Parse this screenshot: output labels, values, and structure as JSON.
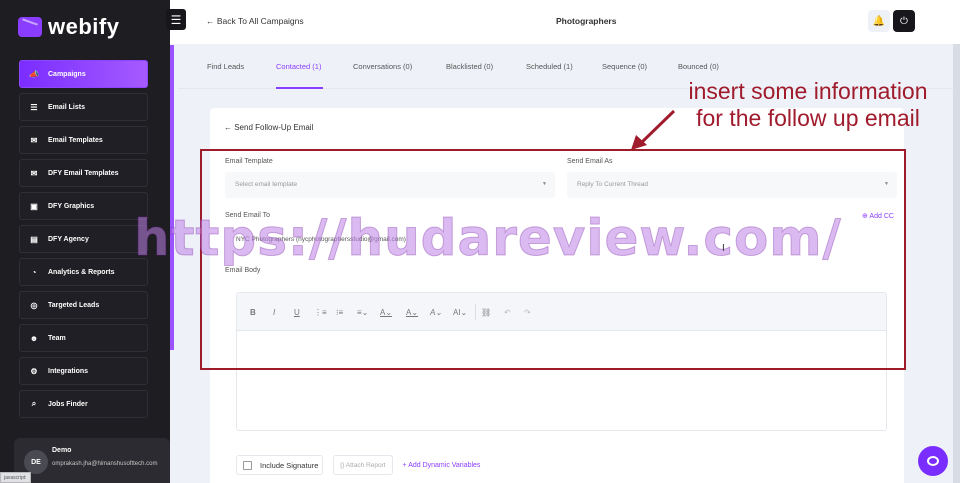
{
  "brand": {
    "name": "webify",
    "accent": "#8b3dff"
  },
  "sidebar": {
    "items": [
      {
        "label": "Campaigns",
        "icon": "megaphone-icon",
        "glyph": "📣"
      },
      {
        "label": "Email Lists",
        "icon": "list-icon",
        "glyph": "☰"
      },
      {
        "label": "Email Templates",
        "icon": "envelope-icon",
        "glyph": "✉"
      },
      {
        "label": "DFY Email Templates",
        "icon": "envelope-open-icon",
        "glyph": "✉"
      },
      {
        "label": "DFY Graphics",
        "icon": "image-icon",
        "glyph": "▣"
      },
      {
        "label": "DFY Agency",
        "icon": "briefcase-icon",
        "glyph": "▤"
      },
      {
        "label": "Analytics & Reports",
        "icon": "pie-chart-icon",
        "glyph": "◔"
      },
      {
        "label": "Targeted Leads",
        "icon": "target-icon",
        "glyph": "◎"
      },
      {
        "label": "Team",
        "icon": "team-icon",
        "glyph": "☻"
      },
      {
        "label": "Integrations",
        "icon": "integrations-icon",
        "glyph": "⚙"
      },
      {
        "label": "Jobs Finder",
        "icon": "search-icon",
        "glyph": "⌕"
      }
    ],
    "user": {
      "initials": "DE",
      "name": "Demo",
      "email": "omprakash.jha@himanshusofttech.com"
    }
  },
  "status_bar": {
    "text": "javascript:"
  },
  "topbar": {
    "back_label": "← Back To All Campaigns",
    "title": "Photographers",
    "menu_glyph": "☰",
    "bell_glyph": "🔔",
    "power_glyph": "⏻"
  },
  "tabs": [
    {
      "label": "Find Leads"
    },
    {
      "label": "Contacted (1)"
    },
    {
      "label": "Conversations (0)"
    },
    {
      "label": "Blacklisted (0)"
    },
    {
      "label": "Scheduled (1)"
    },
    {
      "label": "Sequence (0)"
    },
    {
      "label": "Bounced (0)"
    }
  ],
  "form": {
    "title": "← Send Follow-Up Email",
    "template_label": "Email Template",
    "template_placeholder": "Select email template",
    "send_as_label": "Send Email As",
    "send_as_value": "Reply To Current Thread",
    "send_to_label": "Send Email To",
    "send_to_value": "NYC Photographers (nycphotographersstudio@gmail.com)",
    "add_cc_label": "⊕ Add CC",
    "body_label": "Email Body",
    "caret": "▼",
    "toolbar": {
      "bold": "B",
      "italic": "I",
      "underline": "U",
      "ordered_list": "⋮≡",
      "bullet_list": "⁝≡",
      "align": "≡⌄",
      "bg_color": "A⌄",
      "font_color": "A⌄",
      "font_family": "A⌄",
      "font_size": "AI⌄",
      "link": "⛓",
      "undo": "↶",
      "redo": "↷"
    },
    "include_signature": "Include Signature",
    "attach_report": "{} Attach Report",
    "dynamic_variables": "+ Add Dynamic Variables"
  },
  "annotation": {
    "line1": "insert some information",
    "line2": "for the follow up email",
    "color": "#a01b2c"
  },
  "watermark": "https://hudareview.com/"
}
